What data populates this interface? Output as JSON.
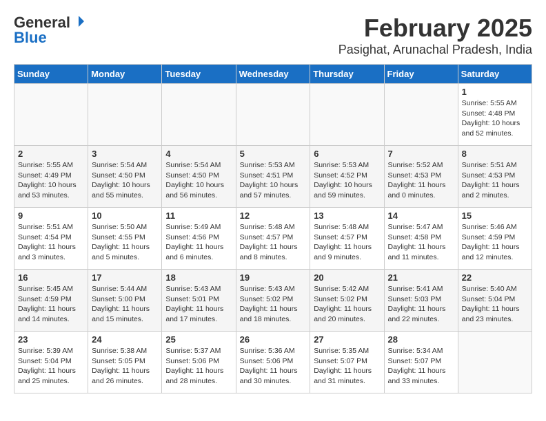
{
  "header": {
    "logo_general": "General",
    "logo_blue": "Blue",
    "month_title": "February 2025",
    "location": "Pasighat, Arunachal Pradesh, India"
  },
  "weekdays": [
    "Sunday",
    "Monday",
    "Tuesday",
    "Wednesday",
    "Thursday",
    "Friday",
    "Saturday"
  ],
  "weeks": [
    [
      {
        "day": "",
        "info": ""
      },
      {
        "day": "",
        "info": ""
      },
      {
        "day": "",
        "info": ""
      },
      {
        "day": "",
        "info": ""
      },
      {
        "day": "",
        "info": ""
      },
      {
        "day": "",
        "info": ""
      },
      {
        "day": "1",
        "info": "Sunrise: 5:55 AM\nSunset: 4:48 PM\nDaylight: 10 hours\nand 52 minutes."
      }
    ],
    [
      {
        "day": "2",
        "info": "Sunrise: 5:55 AM\nSunset: 4:49 PM\nDaylight: 10 hours\nand 53 minutes."
      },
      {
        "day": "3",
        "info": "Sunrise: 5:54 AM\nSunset: 4:50 PM\nDaylight: 10 hours\nand 55 minutes."
      },
      {
        "day": "4",
        "info": "Sunrise: 5:54 AM\nSunset: 4:50 PM\nDaylight: 10 hours\nand 56 minutes."
      },
      {
        "day": "5",
        "info": "Sunrise: 5:53 AM\nSunset: 4:51 PM\nDaylight: 10 hours\nand 57 minutes."
      },
      {
        "day": "6",
        "info": "Sunrise: 5:53 AM\nSunset: 4:52 PM\nDaylight: 10 hours\nand 59 minutes."
      },
      {
        "day": "7",
        "info": "Sunrise: 5:52 AM\nSunset: 4:53 PM\nDaylight: 11 hours\nand 0 minutes."
      },
      {
        "day": "8",
        "info": "Sunrise: 5:51 AM\nSunset: 4:53 PM\nDaylight: 11 hours\nand 2 minutes."
      }
    ],
    [
      {
        "day": "9",
        "info": "Sunrise: 5:51 AM\nSunset: 4:54 PM\nDaylight: 11 hours\nand 3 minutes."
      },
      {
        "day": "10",
        "info": "Sunrise: 5:50 AM\nSunset: 4:55 PM\nDaylight: 11 hours\nand 5 minutes."
      },
      {
        "day": "11",
        "info": "Sunrise: 5:49 AM\nSunset: 4:56 PM\nDaylight: 11 hours\nand 6 minutes."
      },
      {
        "day": "12",
        "info": "Sunrise: 5:48 AM\nSunset: 4:57 PM\nDaylight: 11 hours\nand 8 minutes."
      },
      {
        "day": "13",
        "info": "Sunrise: 5:48 AM\nSunset: 4:57 PM\nDaylight: 11 hours\nand 9 minutes."
      },
      {
        "day": "14",
        "info": "Sunrise: 5:47 AM\nSunset: 4:58 PM\nDaylight: 11 hours\nand 11 minutes."
      },
      {
        "day": "15",
        "info": "Sunrise: 5:46 AM\nSunset: 4:59 PM\nDaylight: 11 hours\nand 12 minutes."
      }
    ],
    [
      {
        "day": "16",
        "info": "Sunrise: 5:45 AM\nSunset: 4:59 PM\nDaylight: 11 hours\nand 14 minutes."
      },
      {
        "day": "17",
        "info": "Sunrise: 5:44 AM\nSunset: 5:00 PM\nDaylight: 11 hours\nand 15 minutes."
      },
      {
        "day": "18",
        "info": "Sunrise: 5:43 AM\nSunset: 5:01 PM\nDaylight: 11 hours\nand 17 minutes."
      },
      {
        "day": "19",
        "info": "Sunrise: 5:43 AM\nSunset: 5:02 PM\nDaylight: 11 hours\nand 18 minutes."
      },
      {
        "day": "20",
        "info": "Sunrise: 5:42 AM\nSunset: 5:02 PM\nDaylight: 11 hours\nand 20 minutes."
      },
      {
        "day": "21",
        "info": "Sunrise: 5:41 AM\nSunset: 5:03 PM\nDaylight: 11 hours\nand 22 minutes."
      },
      {
        "day": "22",
        "info": "Sunrise: 5:40 AM\nSunset: 5:04 PM\nDaylight: 11 hours\nand 23 minutes."
      }
    ],
    [
      {
        "day": "23",
        "info": "Sunrise: 5:39 AM\nSunset: 5:04 PM\nDaylight: 11 hours\nand 25 minutes."
      },
      {
        "day": "24",
        "info": "Sunrise: 5:38 AM\nSunset: 5:05 PM\nDaylight: 11 hours\nand 26 minutes."
      },
      {
        "day": "25",
        "info": "Sunrise: 5:37 AM\nSunset: 5:06 PM\nDaylight: 11 hours\nand 28 minutes."
      },
      {
        "day": "26",
        "info": "Sunrise: 5:36 AM\nSunset: 5:06 PM\nDaylight: 11 hours\nand 30 minutes."
      },
      {
        "day": "27",
        "info": "Sunrise: 5:35 AM\nSunset: 5:07 PM\nDaylight: 11 hours\nand 31 minutes."
      },
      {
        "day": "28",
        "info": "Sunrise: 5:34 AM\nSunset: 5:07 PM\nDaylight: 11 hours\nand 33 minutes."
      },
      {
        "day": "",
        "info": ""
      }
    ]
  ]
}
